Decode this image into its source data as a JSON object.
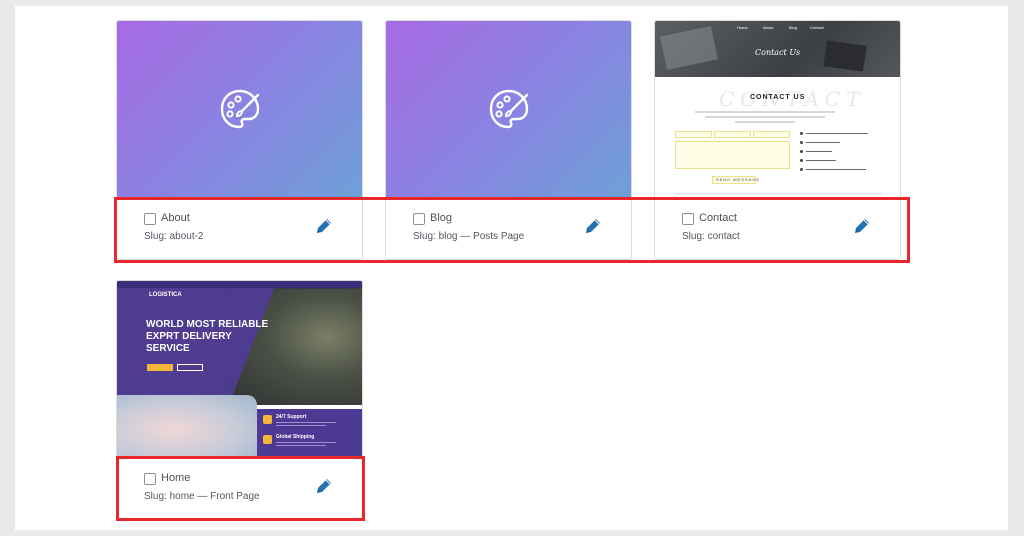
{
  "pages": [
    {
      "title": "About",
      "slug": "Slug: about-2",
      "thumbnail": "palette-icon"
    },
    {
      "title": "Blog",
      "slug": "Slug: blog — Posts Page",
      "thumbnail": "palette-icon"
    },
    {
      "title": "Contact",
      "slug": "Slug: contact",
      "thumbnail": "contact-preview"
    },
    {
      "title": "Home",
      "slug": "Slug: home — Front Page",
      "thumbnail": "home-preview"
    }
  ],
  "contact_preview": {
    "nav": [
      "Home",
      "About",
      "Blog",
      "Contact"
    ],
    "hero_title": "Contact Us",
    "heading": "CONTACT US",
    "watermark": "CONTACT",
    "button": "SEND MESSAGE"
  },
  "home_preview": {
    "logo": "LOGISTICA",
    "headline": "WORLD MOST RELIABLE EXPRT DELIVERY SERVICE",
    "feature1": "24/7 Support",
    "feature2": "Global Shipping"
  },
  "colors": {
    "highlight": "#e8272a",
    "edit_icon": "#2271b1",
    "gradient_start": "#a86ae3",
    "gradient_end": "#6ea0d8"
  }
}
